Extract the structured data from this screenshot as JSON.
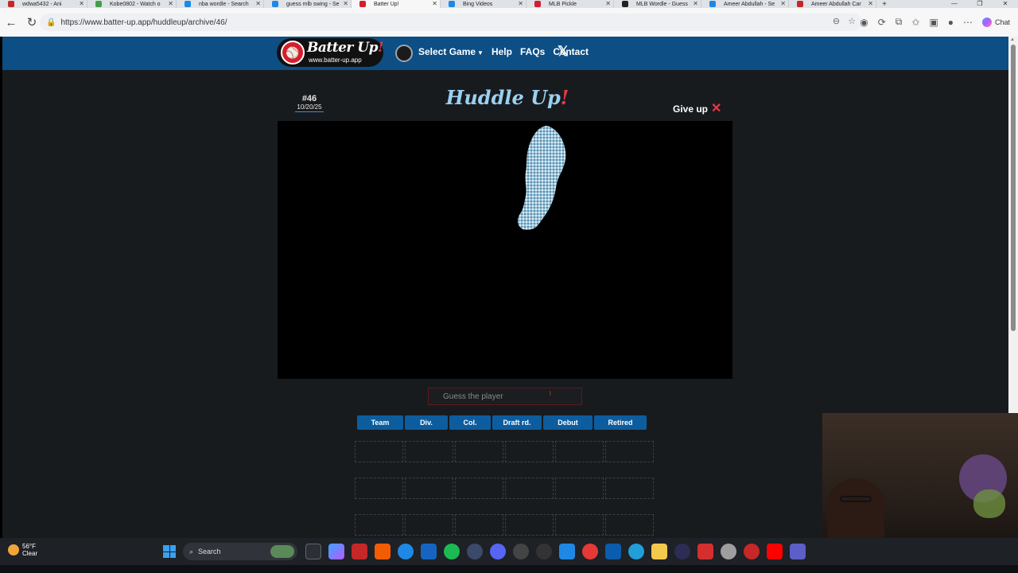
{
  "browser": {
    "tabs": [
      {
        "title": "wdwa5432 - Ani",
        "color": "#c62828"
      },
      {
        "title": "Kobe0802 - Watch o",
        "color": "#43a047"
      },
      {
        "title": "nba wordle - Search",
        "color": "#1e88e5"
      },
      {
        "title": "guess mlb swing - Se",
        "color": "#1e88e5"
      },
      {
        "title": "Batter Up!",
        "color": "#d41f2e",
        "active": true
      },
      {
        "title": "Bing Videos",
        "color": "#1e88e5"
      },
      {
        "title": "MLB Pickle",
        "color": "#d41f2e"
      },
      {
        "title": "MLB Wordle - Guess",
        "color": "#222222"
      },
      {
        "title": "Ameer Abdullah - Se",
        "color": "#1e88e5"
      },
      {
        "title": "Ameer Abdullah Car",
        "color": "#c62828"
      }
    ],
    "new_tab": "+",
    "url": "https://www.batter-up.app/huddleup/archive/46/",
    "chat_label": "Chat"
  },
  "site": {
    "logo_title": "Batter Up",
    "logo_exclaim": "!",
    "logo_url": "www.batter-up.app",
    "nav": {
      "select_game": "Select Game",
      "help": "Help",
      "faqs": "FAQs",
      "contact": "Contact"
    },
    "accent_color": "#0d4e85"
  },
  "game": {
    "number": "#46",
    "date": "10/20/25",
    "title": "Huddle Up",
    "title_exclaim": "!",
    "give_up": "Give up",
    "guess_placeholder": "Guess the player",
    "columns": [
      "Team",
      "Div.",
      "Col.",
      "Draft rd.",
      "Debut",
      "Retired"
    ],
    "empty_guess_rows": 3
  },
  "taskbar": {
    "temperature": "56°F",
    "condition": "Clear",
    "search_label": "Search"
  }
}
